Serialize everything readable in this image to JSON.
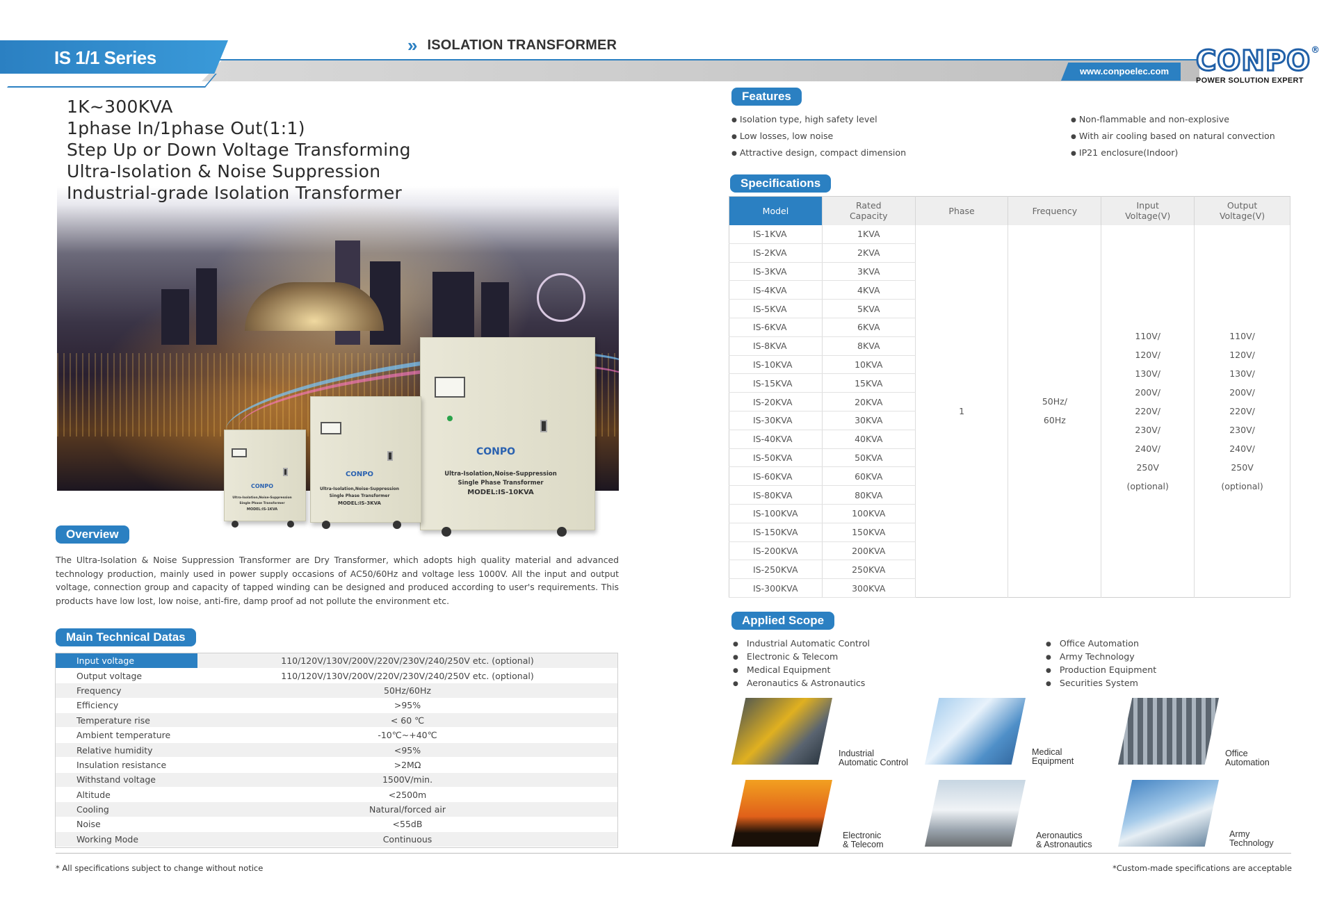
{
  "header": {
    "series": "IS 1/1 Series",
    "title": "ISOLATION TRANSFORMER",
    "url": "www.conpoelec.com",
    "logo_text": "CONPO",
    "logo_reg": "®",
    "logo_tagline": "POWER SOLUTION EXPERT"
  },
  "headline": [
    "1K~300KVA",
    "1phase In/1phase Out(1:1)",
    "Step Up or Down Voltage Transforming",
    "Ultra-Isolation & Noise Suppression",
    "Industrial-grade Isolation Transformer"
  ],
  "product_labels": {
    "brand": "CONPO",
    "large_line1": "Ultra-Isolation,Noise-Suppression",
    "large_line2": "Single Phase Transformer",
    "large_model": "MODEL:IS-10KVA",
    "medium_line1": "Ultra-Isolation,Noise-Suppression",
    "medium_line2": "Single Phase Transformer",
    "medium_model": "MODEL:IS-3KVA",
    "small_line1": "Ultra-Isolation,Noise-Suppression",
    "small_line2": "Single Phase Transformer",
    "small_model": "MODEL:IS-1KVA"
  },
  "overview": {
    "title": "Overview",
    "text": "The Ultra-Isolation & Noise Suppression Transformer are Dry Transformer, which adopts high quality material and advanced technology production, mainly used in power supply occasions of AC50/60Hz and voltage less 1000V.  All the input and output voltage, connection group and capacity of tapped winding can be designed and produced according to user's requirements. This products have low lost, low noise, anti-fire, damp proof ad not pollute the environment etc."
  },
  "tech": {
    "title": "Main Technical Datas",
    "rows": [
      {
        "k": "Input voltage",
        "v": "110/120V/130V/200V/220V/230V/240/250V etc. (optional)"
      },
      {
        "k": "Output voltage",
        "v": "110/120V/130V/200V/220V/230V/240/250V etc. (optional)"
      },
      {
        "k": "Frequency",
        "v": "50Hz/60Hz"
      },
      {
        "k": "Efficiency",
        "v": ">95%"
      },
      {
        "k": "Temperature rise",
        "v": "< 60 ℃"
      },
      {
        "k": "Ambient temperature",
        "v": "-10℃~+40℃"
      },
      {
        "k": "Relative humidity",
        "v": "<95%"
      },
      {
        "k": "Insulation resistance",
        "v": ">2MΩ"
      },
      {
        "k": "Withstand voltage",
        "v": "1500V/min."
      },
      {
        "k": "Altitude",
        "v": "<2500m"
      },
      {
        "k": "Cooling",
        "v": "Natural/forced air"
      },
      {
        "k": "Noise",
        "v": "<55dB"
      },
      {
        "k": "Working Mode",
        "v": "Continuous"
      }
    ]
  },
  "features": {
    "title": "Features",
    "left": [
      "Isolation type, high safety level",
      "Low losses, low noise",
      "Attractive design, compact dimension"
    ],
    "right": [
      "Non-flammable and non-explosive",
      "With air cooling based on natural convection",
      "IP21 enclosure(Indoor)"
    ]
  },
  "specs": {
    "title": "Specifications",
    "headers": [
      "Model",
      "Rated Capacity",
      "Phase",
      "Frequency",
      "Input Voltage(V)",
      "Output Voltage(V)"
    ],
    "rows": [
      [
        "IS-1KVA",
        "1KVA"
      ],
      [
        "IS-2KVA",
        "2KVA"
      ],
      [
        "IS-3KVA",
        "3KVA"
      ],
      [
        "IS-4KVA",
        "4KVA"
      ],
      [
        "IS-5KVA",
        "5KVA"
      ],
      [
        "IS-6KVA",
        "6KVA"
      ],
      [
        "IS-8KVA",
        "8KVA"
      ],
      [
        "IS-10KVA",
        "10KVA"
      ],
      [
        "IS-15KVA",
        "15KVA"
      ],
      [
        "IS-20KVA",
        "20KVA"
      ],
      [
        "IS-30KVA",
        "30KVA"
      ],
      [
        "IS-40KVA",
        "40KVA"
      ],
      [
        "IS-50KVA",
        "50KVA"
      ],
      [
        "IS-60KVA",
        "60KVA"
      ],
      [
        "IS-80KVA",
        "80KVA"
      ],
      [
        "IS-100KVA",
        "100KVA"
      ],
      [
        "IS-150KVA",
        "150KVA"
      ],
      [
        "IS-200KVA",
        "200KVA"
      ],
      [
        "IS-250KVA",
        "250KVA"
      ],
      [
        "IS-300KVA",
        "300KVA"
      ]
    ],
    "phase": "1",
    "frequency_lines": [
      "50Hz/",
      "60Hz"
    ],
    "input_lines": [
      "110V/",
      "120V/",
      "130V/",
      "200V/",
      "220V/",
      "230V/",
      "240V/",
      "250V",
      "(optional)"
    ],
    "output_lines": [
      "110V/",
      "120V/",
      "130V/",
      "200V/",
      "220V/",
      "230V/",
      "240V/",
      "250V",
      "(optional)"
    ]
  },
  "scope": {
    "title": "Applied Scope",
    "left": [
      "Industrial Automatic Control",
      "Electronic & Telecom",
      "Medical Equipment",
      "Aeronautics & Astronautics"
    ],
    "right": [
      "Office Automation",
      "Army Technology",
      "Production Equipment",
      "Securities System"
    ],
    "tiles": [
      {
        "l1": "Industrial",
        "l2": "Automatic Control",
        "icon": "industrial-robot-photo"
      },
      {
        "l1": "Medical",
        "l2": "Equipment",
        "icon": "medical-room-photo"
      },
      {
        "l1": "Office",
        "l2": "Automation",
        "icon": "server-room-photo"
      },
      {
        "l1": "Electronic",
        "l2": "& Telecom",
        "icon": "power-tower-photo"
      },
      {
        "l1": "Aeronautics",
        "l2": "& Astronautics",
        "icon": "airplane-photo"
      },
      {
        "l1": "Army",
        "l2": "Technology",
        "icon": "radar-dish-photo"
      }
    ]
  },
  "footer": {
    "left": "All specifications subject to change without notice",
    "right": "Custom-made specifications are acceptable",
    "star": "*"
  }
}
